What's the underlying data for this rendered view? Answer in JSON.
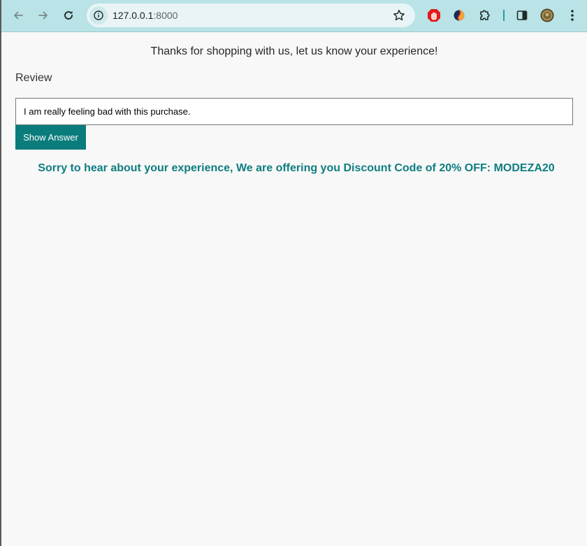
{
  "browser": {
    "url_host": "127.0.0.1",
    "url_port": ":8000",
    "icons": {
      "back": "arrow-left-icon",
      "forward": "arrow-right-icon",
      "reload": "reload-icon",
      "site_info": "info-icon",
      "bookmark": "star-icon",
      "extensions": [
        "adblock-stop-hand-icon",
        "split-circle-extension-icon",
        "puzzle-piece-icon",
        "side-panel-icon",
        "profile-avatar-icon",
        "three-dot-menu-icon"
      ]
    },
    "colors": {
      "toolbar": "#b9e3e6",
      "omnibox": "#e8f4f5"
    }
  },
  "page": {
    "greeting": "Thanks for shopping with us, let us know your experience!",
    "review_label": "Review",
    "review_value": "I am really feeling bad with this purchase.",
    "button_label": "Show Answer",
    "answer": "Sorry to hear about your experience, We are offering you Discount Code of 20% OFF: MODEZA20",
    "colors": {
      "accent": "#0a7c7c",
      "answer_text": "#0f7d80",
      "background": "#f8f8f8"
    }
  }
}
